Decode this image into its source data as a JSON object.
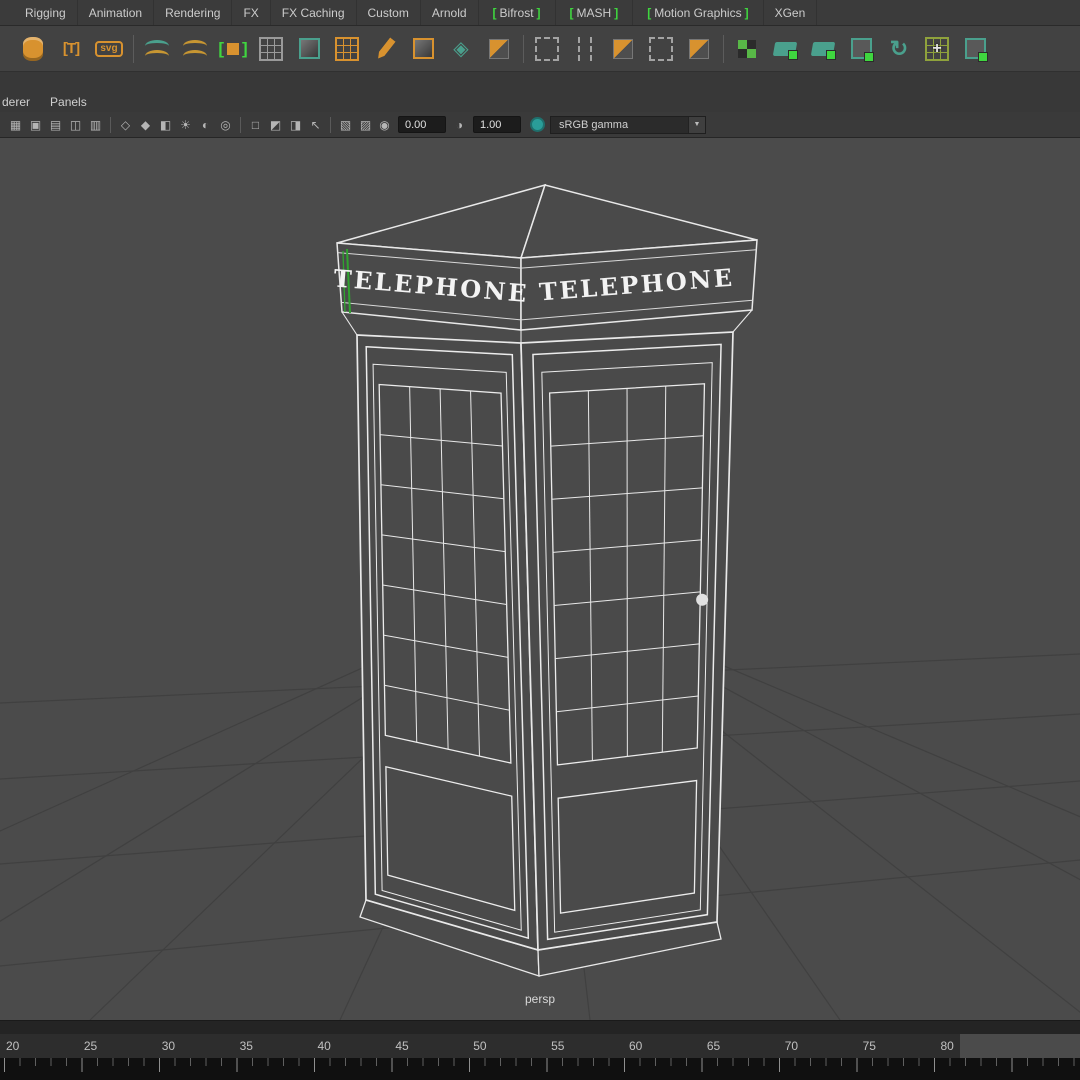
{
  "colors": {
    "bracket_green": "#3fd63f",
    "shelf_orange": "#d8922f",
    "shelf_teal": "#4aa08d",
    "viewport_bg": "#4b4b4b",
    "selection_green": "#2fa42f"
  },
  "tab_bar": {
    "tabs": [
      {
        "lb": "",
        "label": "Rigging",
        "rb": ""
      },
      {
        "lb": "",
        "label": "Animation",
        "rb": ""
      },
      {
        "lb": "",
        "label": "Rendering",
        "rb": ""
      },
      {
        "lb": "",
        "label": "FX",
        "rb": ""
      },
      {
        "lb": "",
        "label": "FX Caching",
        "rb": ""
      },
      {
        "lb": "",
        "label": "Custom",
        "rb": ""
      },
      {
        "lb": "",
        "label": "Arnold",
        "rb": ""
      },
      {
        "lb": "[",
        "label": "Bifrost",
        "rb": "]"
      },
      {
        "lb": "[",
        "label": "MASH",
        "rb": "]"
      },
      {
        "lb": "[",
        "label": "Motion Graphics",
        "rb": "]"
      },
      {
        "lb": "",
        "label": "XGen",
        "rb": ""
      }
    ]
  },
  "shelf": {
    "icons": [
      {
        "name": "cylinder-primitive-icon",
        "kind": "barrel",
        "c": "#d8922f"
      },
      {
        "name": "type-tool-icon",
        "kind": "glyph",
        "c": "#d8922f",
        "glyph": "[T]"
      },
      {
        "name": "svg-tool-icon",
        "kind": "badge",
        "c": "#d8922f",
        "glyph": "svg"
      },
      {
        "kind": "divider"
      },
      {
        "name": "curves-tool-icon",
        "kind": "wave",
        "c": "#4aa08d"
      },
      {
        "name": "surfaces-tool-icon",
        "kind": "wave",
        "c": "#c79632"
      },
      {
        "name": "bracket-object-icon",
        "kind": "bracketcube",
        "c": "#d8922f"
      },
      {
        "name": "poly-plane-icon",
        "kind": "grid",
        "c": "#9a9a9a"
      },
      {
        "name": "poly-cube-icon",
        "kind": "cube",
        "c": "#4aa08d"
      },
      {
        "name": "uv-grid-icon",
        "kind": "grid",
        "c": "#d8922f"
      },
      {
        "name": "pencil-curve-icon",
        "kind": "pencil",
        "c": "#d8922f"
      },
      {
        "name": "poly-cube-orange-icon",
        "kind": "cube",
        "c": "#d8922f"
      },
      {
        "name": "construction-layers-icon",
        "kind": "diamond",
        "c": "#4aa08d"
      },
      {
        "name": "poly-cube-solid-icon",
        "kind": "split",
        "c": "#d8922f"
      },
      {
        "kind": "divider"
      },
      {
        "name": "lattice-deformer-icon",
        "kind": "dashed",
        "c": "#a3a3a3"
      },
      {
        "name": "insert-edge-loop-icon",
        "kind": "dashedv",
        "c": "#a3a3a3"
      },
      {
        "name": "multi-cut-icon",
        "kind": "split",
        "c": "#d8922f"
      },
      {
        "name": "marquee-select-icon",
        "kind": "dashed",
        "c": "#a3a3a3"
      },
      {
        "name": "quad-draw-icon",
        "kind": "split",
        "c": "#d8922f"
      },
      {
        "kind": "divider"
      },
      {
        "name": "mash-network-icon",
        "kind": "checker",
        "c": "#58b847"
      },
      {
        "name": "mash-plane-icon",
        "kind": "flag",
        "c": "#4aa08d"
      },
      {
        "name": "mash-surface-icon",
        "kind": "flag",
        "c": "#4aa08d"
      },
      {
        "name": "mash-cube-icon",
        "kind": "cubechk",
        "c": "#4aa08d"
      },
      {
        "name": "mash-flow-icon",
        "kind": "swirl",
        "c": "#4aa08d"
      },
      {
        "name": "mash-grid-icon",
        "kind": "gridplus",
        "c": "#8fa23c"
      },
      {
        "name": "mash-world-icon",
        "kind": "cubechk",
        "c": "#4aa08d"
      }
    ]
  },
  "panel_menu": {
    "renderer_label": "derer",
    "panels_label": "Panels"
  },
  "viewport_toolbar": {
    "icons": [
      {
        "name": "grid-toggle-icon",
        "glyph": "▦"
      },
      {
        "name": "panel-single-icon",
        "glyph": "▣"
      },
      {
        "name": "panel-four-view-icon",
        "glyph": "▤"
      },
      {
        "name": "panel-split-icon",
        "glyph": "◫"
      },
      {
        "name": "panel-outliner-icon",
        "glyph": "▥"
      },
      {
        "kind": "sep"
      },
      {
        "name": "wireframe-display-icon",
        "glyph": "◇"
      },
      {
        "name": "shaded-display-icon",
        "glyph": "◆"
      },
      {
        "name": "textured-display-icon",
        "glyph": "◧"
      },
      {
        "name": "use-all-lights-icon",
        "glyph": "☀"
      },
      {
        "name": "shadows-toggle-icon",
        "glyph": "◐"
      },
      {
        "name": "ambient-occlusion-icon",
        "glyph": "◎"
      },
      {
        "kind": "sep"
      },
      {
        "name": "xray-display-icon",
        "glyph": "□"
      },
      {
        "name": "isolate-select-icon",
        "glyph": "◩"
      },
      {
        "name": "camera-attributes-icon",
        "glyph": "◨"
      },
      {
        "name": "select-cursor-icon",
        "glyph": "↖"
      },
      {
        "kind": "sep"
      },
      {
        "name": "image-plane-icon",
        "glyph": "▧"
      },
      {
        "name": "film-gate-icon",
        "glyph": "▨"
      }
    ],
    "exposure_icon": "◉",
    "exposure_value": "0.00",
    "gamma_icon": "◑",
    "gamma_value": "1.00",
    "colorspace": "sRGB gamma",
    "dropdown_arrow": "▼"
  },
  "viewport": {
    "camera_label": "persp",
    "sign_text": "TELEPHONE"
  },
  "timeline": {
    "ticks": [
      "20",
      "25",
      "30",
      "35",
      "40",
      "45",
      "50",
      "55",
      "60",
      "65",
      "70",
      "75",
      "80"
    ]
  }
}
